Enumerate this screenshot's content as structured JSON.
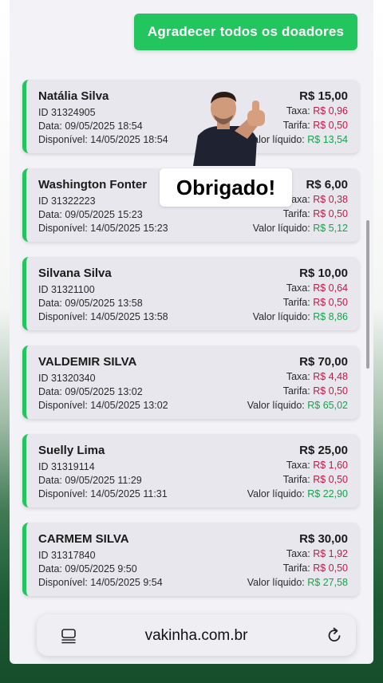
{
  "header": {
    "thank_all_label": "Agradecer todos os doadores"
  },
  "overlay": {
    "thanks_text": "Obrigado!"
  },
  "labels": {
    "taxa": "Taxa:",
    "tarifa": "Tarifa:",
    "liquido": "Valor líquido:"
  },
  "donations": [
    {
      "name": "Natália Silva",
      "id": "ID 31324905",
      "date": "Data: 09/05/2025 18:54",
      "available": "Disponível: 14/05/2025 18:54",
      "amount": "R$ 15,00",
      "taxa": "R$ 0,96",
      "tarifa": "R$ 0,50",
      "liquido": "R$ 13,54"
    },
    {
      "name": "Washington Fonter",
      "id": "ID 31322223",
      "date": "Data: 09/05/2025 15:23",
      "available": "Disponível: 14/05/2025 15:23",
      "amount": "R$ 6,00",
      "taxa": "R$ 0,38",
      "tarifa": "R$ 0,50",
      "liquido": "R$ 5,12"
    },
    {
      "name": "Silvana Silva",
      "id": "ID 31321100",
      "date": "Data: 09/05/2025 13:58",
      "available": "Disponível: 14/05/2025 13:58",
      "amount": "R$ 10,00",
      "taxa": "R$ 0,64",
      "tarifa": "R$ 0,50",
      "liquido": "R$ 8,86"
    },
    {
      "name": "VALDEMIR SILVA",
      "id": "ID 31320340",
      "date": "Data: 09/05/2025 13:02",
      "available": "Disponível: 14/05/2025 13:02",
      "amount": "R$ 70,00",
      "taxa": "R$ 4,48",
      "tarifa": "R$ 0,50",
      "liquido": "R$ 65,02"
    },
    {
      "name": "Suelly Lima",
      "id": "ID 31319114",
      "date": "Data: 09/05/2025 11:29",
      "available": "Disponível: 14/05/2025 11:31",
      "amount": "R$ 25,00",
      "taxa": "R$ 1,60",
      "tarifa": "R$ 0,50",
      "liquido": "R$ 22,90"
    },
    {
      "name": "CARMEM SILVA",
      "id": "ID 31317840",
      "date": "Data: 09/05/2025 9:50",
      "available": "Disponível: 14/05/2025 9:54",
      "amount": "R$ 30,00",
      "taxa": "R$ 1,92",
      "tarifa": "R$ 0,50",
      "liquido": "R$ 27,58"
    }
  ],
  "browser": {
    "url": "vakinha.com.br",
    "reader_icon": "reader-mode-icon",
    "reload_icon": "reload-icon"
  },
  "colors": {
    "accent": "#22c55e",
    "fee": "#be1b46",
    "net": "#16a34a"
  }
}
